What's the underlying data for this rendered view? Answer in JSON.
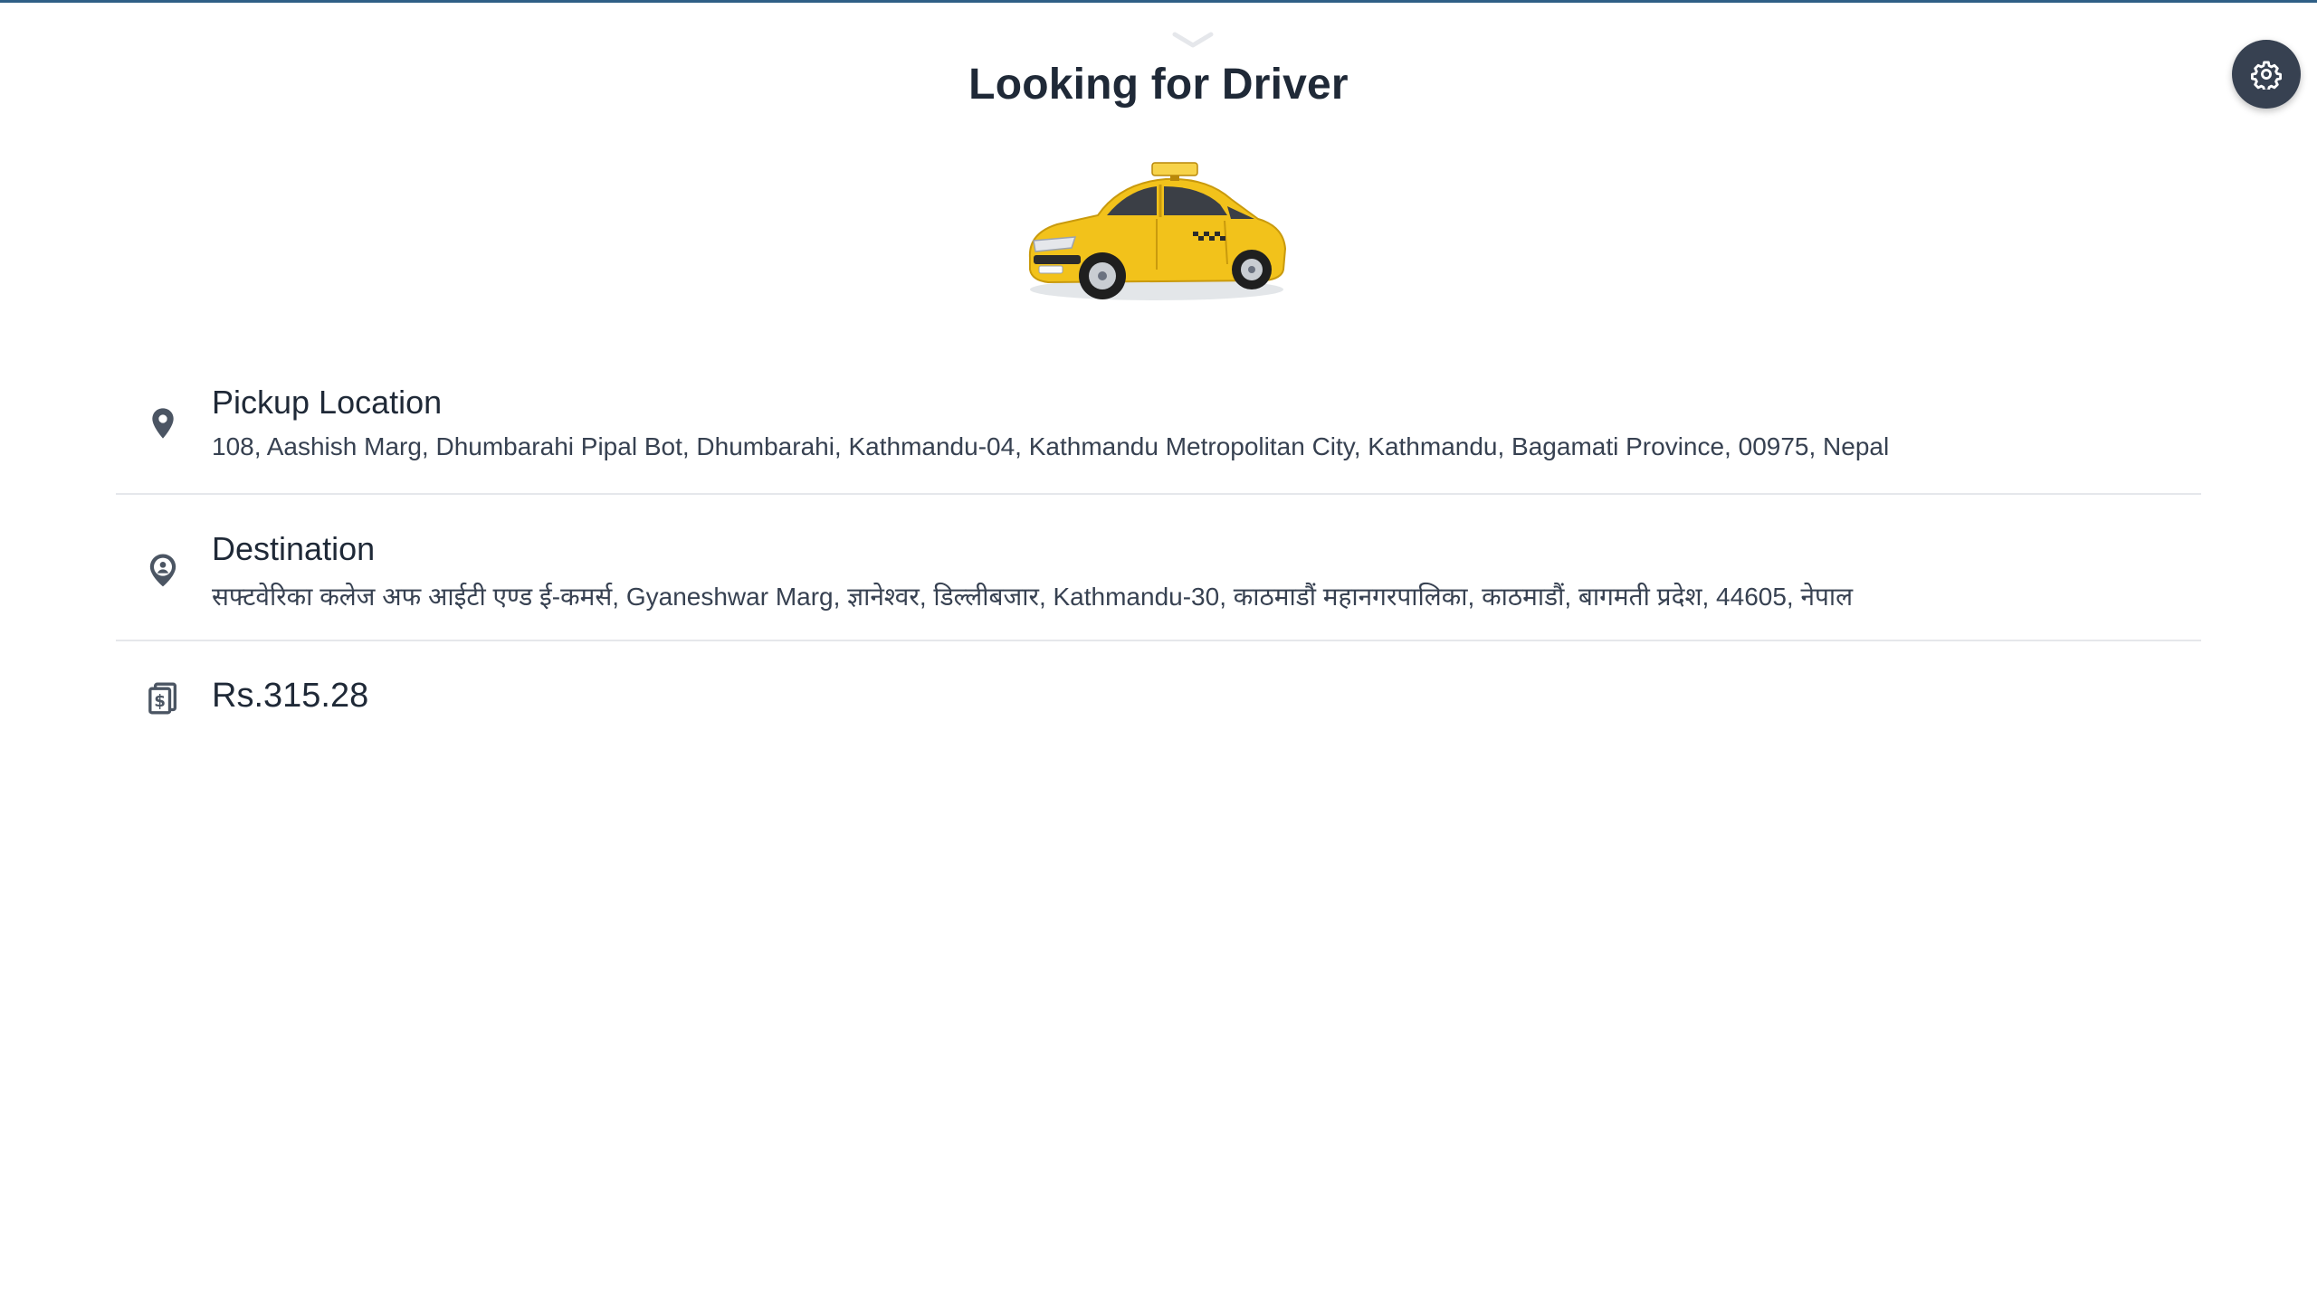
{
  "header": {
    "title": "Looking for Driver"
  },
  "pickup": {
    "heading": "Pickup Location",
    "address": "108, Aashish Marg, Dhumbarahi Pipal Bot, Dhumbarahi, Kathmandu-04, Kathmandu Metropolitan City, Kathmandu, Bagamati Province, 00975, Nepal"
  },
  "destination": {
    "heading": "Destination",
    "address": "सफ्टवेरिका कलेज अफ आईटी एण्ड ई-कमर्स, Gyaneshwar Marg, ज्ञानेश्वर, डिल्लीबजार, Kathmandu-30, काठमाडौं महानगरपालिका, काठमाडौं, बागमती प्रदेश, 44605, नेपाल"
  },
  "fare": {
    "amount": "Rs.315.28"
  },
  "icons": {
    "pickup": "map-pin-icon",
    "destination": "user-pin-icon",
    "fare": "receipt-money-icon",
    "settings": "gear-icon",
    "handle": "chevron-down-icon"
  },
  "colors": {
    "top_border": "#2f5f86",
    "settings_bg": "#374151",
    "taxi_yellow": "#f2c21b"
  }
}
